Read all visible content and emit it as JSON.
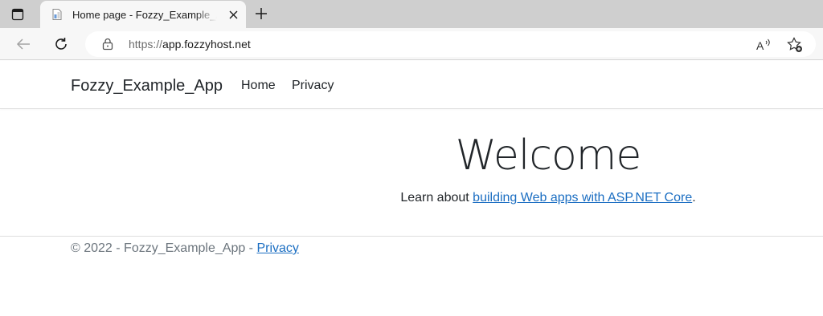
{
  "browser": {
    "tab_title": "Home page - Fozzy_Example_App",
    "url_scheme": "https://",
    "url_host": "app.fozzyhost.net",
    "icons": [
      "tab-actions-icon",
      "page-icon",
      "close-icon",
      "plus-icon",
      "back-arrow-icon",
      "reload-icon",
      "lock-icon",
      "read-aloud-icon",
      "add-favorite-icon"
    ]
  },
  "navbar": {
    "brand": "Fozzy_Example_App",
    "links": [
      "Home",
      "Privacy"
    ]
  },
  "main": {
    "heading": "Welcome",
    "intro_text": "Learn about ",
    "intro_link": "building Web apps with ASP.NET Core",
    "intro_end": "."
  },
  "footer": {
    "text": "© 2022 - Fozzy_Example_App - ",
    "privacy_link": "Privacy"
  },
  "colors": {
    "link": "#1b6ec2",
    "text": "#212529",
    "muted": "#6c757d",
    "chrome_bg": "#cfcfcf",
    "toolbar_bg": "#f7f7f7"
  }
}
